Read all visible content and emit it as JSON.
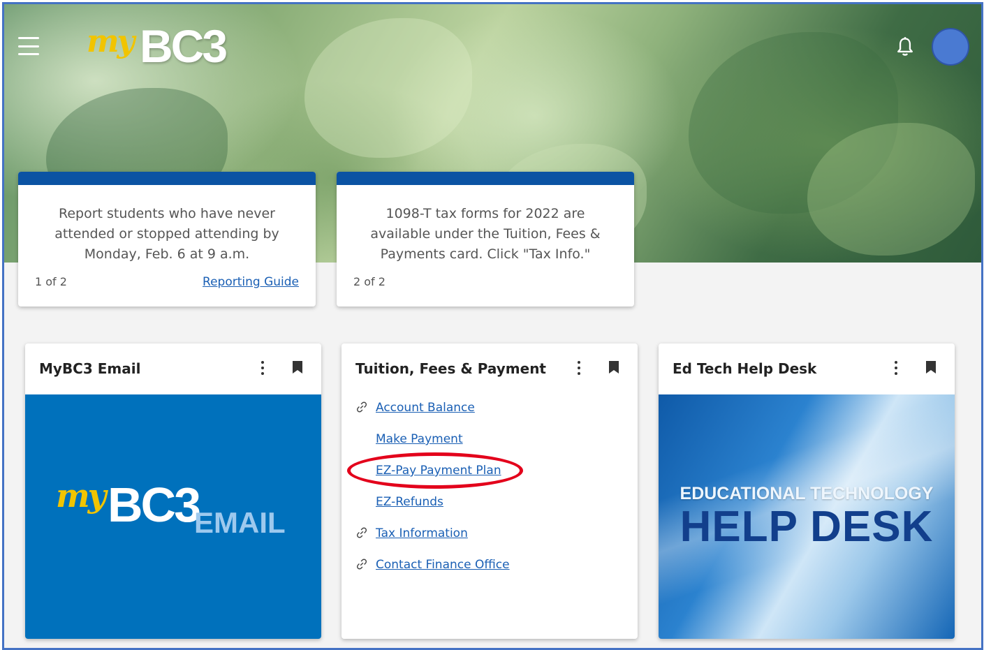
{
  "header": {
    "logo_my": "my",
    "logo_bc3": "BC3",
    "menu_icon": "hamburger-menu-icon",
    "notification_icon": "bell-icon"
  },
  "announcements": [
    {
      "message": "Report students who have never attended or stopped attending by Monday, Feb. 6 at 9 a.m.",
      "pager": "1 of 2",
      "link": "Reporting Guide"
    },
    {
      "message": "1098-T tax forms for 2022 are available under the Tuition, Fees & Payments card. Click \"Tax Info.\"",
      "pager": "2 of 2"
    }
  ],
  "cards": {
    "email": {
      "title": "MyBC3 Email",
      "image_my": "my",
      "image_bc3": "BC3",
      "image_word": "EMAIL"
    },
    "tuition": {
      "title": "Tuition, Fees & Payment",
      "links": [
        {
          "label": "Account Balance",
          "icon": "link-icon"
        },
        {
          "label": "Make Payment",
          "icon": ""
        },
        {
          "label": "EZ-Pay Payment Plan",
          "icon": ""
        },
        {
          "label": "EZ-Refunds",
          "icon": ""
        },
        {
          "label": "Tax Information",
          "icon": "link-icon"
        },
        {
          "label": "Contact Finance Office",
          "icon": "link-icon"
        }
      ]
    },
    "helpdesk": {
      "title": "Ed Tech Help Desk",
      "image_line1": "EDUCATIONAL TECHNOLOGY",
      "image_line2": "HELP DESK"
    }
  },
  "colors": {
    "accent_blue": "#0b53a3",
    "link_blue": "#1a5fb4",
    "highlight_red": "#e3001b",
    "logo_yellow": "#f1c400"
  }
}
